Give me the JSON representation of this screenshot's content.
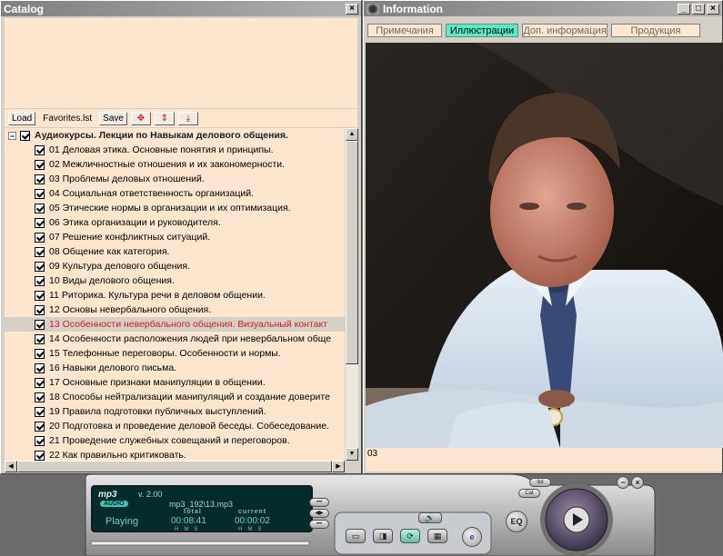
{
  "catalog": {
    "title": "Catalog",
    "close": "×",
    "toolbar": {
      "load": "Load",
      "favorites": "Favorites.lst",
      "save": "Save"
    },
    "root_label": "Аудиокурсы. Лекции по Навыкам делового общения.",
    "items": [
      "01 Деловая этика. Основные понятия и принципы.",
      "02 Межличностные отношения и их закономерности.",
      "03 Проблемы деловых отношений.",
      "04 Социальная ответственность организаций.",
      "05 Этические нормы в организации и их оптимизация.",
      "06 Этика организации и  руководителя.",
      "07 Решение конфликтных ситуаций.",
      "08 Общение как категория.",
      "09 Культура делового общения.",
      "10 Виды делового общения.",
      "11 Риторика. Культура речи в деловом общении.",
      "12 Основы невербального общения.",
      "13 Особенности невербального общения. Визуальный контакт",
      "14 Особенности расположения людей при невербальном обще",
      "15 Телефонные переговоры. Особенности и нормы.",
      "16 Навыки делового письма.",
      "17 Основные признаки манипуляции в общении.",
      "18 Способы нейтрализации манипуляций и создание доверите",
      "19 Правила подготовки публичных выступлений.",
      "20 Подготовка и проведение деловой беседы. Собеседование.",
      "21 Проведение служебных совещаний и переговоров.",
      "22 Как правильно критиковать."
    ],
    "selected_index": 12
  },
  "info": {
    "title": "Information",
    "tabs": [
      "Примечания",
      "Иллюстрации",
      "Доп. информация",
      "Продукция"
    ],
    "active_tab": 1,
    "caption": "03"
  },
  "player": {
    "logo": "mp3",
    "audio": "AUDIO",
    "version": "v. 2.00",
    "file": "mp3_192\\13.mp3",
    "state": "Playing",
    "total_label": "total",
    "current_label": "current",
    "total_time": "00:08:41",
    "current_time": "00:00:02",
    "hms": "HMS",
    "eq": "EQ",
    "list": "list",
    "cat": "Cat"
  },
  "colors": {
    "list_bg": "#fde6cf",
    "selected_text": "#d01c1c",
    "active_tab": "#4ff0c8"
  }
}
